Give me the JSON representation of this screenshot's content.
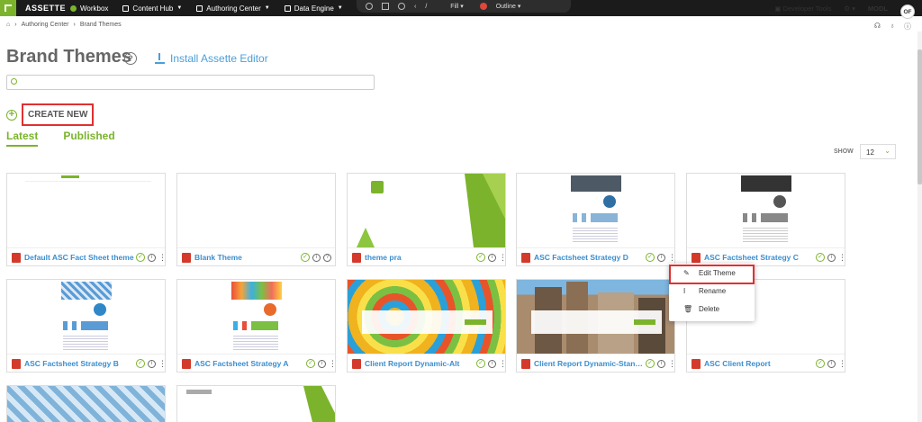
{
  "topbar": {
    "brand": "ASSETTE",
    "nav": [
      {
        "label": "Workbox",
        "icon": "workbox-icon",
        "has_menu": false
      },
      {
        "label": "Content Hub",
        "icon": "content-hub-icon",
        "has_menu": true
      },
      {
        "label": "Authoring Center",
        "icon": "authoring-icon",
        "has_menu": true
      },
      {
        "label": "Data Engine",
        "icon": "data-engine-icon",
        "has_menu": true
      }
    ],
    "annot_fill": "Fill",
    "annot_outline": "Outline",
    "developer_tools": "Developer Tools",
    "user_code": "MODL",
    "avatar_initials": "OF"
  },
  "breadcrumb": [
    "Authoring Center",
    "Brand Themes"
  ],
  "page": {
    "title": "Brand Themes",
    "help": "?",
    "install_label": "Install Assette Editor",
    "search_placeholder": "",
    "create_new": "CREATE NEW",
    "tabs": [
      "Latest",
      "Published"
    ],
    "show_label": "SHOW",
    "show_value": "12"
  },
  "cards": [
    {
      "name": "Default ASC Fact Sheet theme",
      "thumb": "blank-logo"
    },
    {
      "name": "Blank Theme",
      "thumb": "blank"
    },
    {
      "name": "theme pra",
      "thumb": "green-shapes"
    },
    {
      "name": "ASC Factsheet Strategy D",
      "thumb": "factsheet-dark"
    },
    {
      "name": "ASC Factsheet Strategy C",
      "thumb": "factsheet-bw"
    },
    {
      "name": "ASC Factsheet Strategy B",
      "thumb": "factsheet-blue"
    },
    {
      "name": "ASC Factsheet Strategy A",
      "thumb": "factsheet-color"
    },
    {
      "name": "Client Report Dynamic-Alt",
      "thumb": "colorful"
    },
    {
      "name": "Client Report Dynamic-Standard",
      "thumb": "city"
    },
    {
      "name": "ASC Client Report",
      "thumb": "blank"
    },
    {
      "name": "",
      "thumb": "pattern"
    },
    {
      "name": "",
      "thumb": "assette-green"
    }
  ],
  "context_menu": [
    "Edit Theme",
    "Rename",
    "Delete"
  ],
  "colors": {
    "accent": "#7bb42c",
    "link": "#3a8ed0",
    "highlight": "#e03030"
  }
}
